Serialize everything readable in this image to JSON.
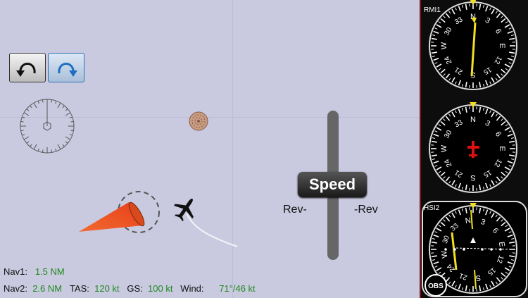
{
  "controls": {
    "turn_left_icon": "turn-left-arrow-icon",
    "turn_right_icon": "turn-right-arrow-icon",
    "speed_label": "Speed",
    "rev_minus_label": "Rev-",
    "rev_plus_label": "-Rev"
  },
  "status": {
    "nav1_label": "Nav1:",
    "nav1_value": "1.5 NM",
    "nav2_label": "Nav2:",
    "nav2_value": "2.6 NM",
    "tas_label": "TAS:",
    "tas_value": "120 kt",
    "gs_label": "GS:",
    "gs_value": "100 kt",
    "wind_label": "Wind:",
    "wind_value": "71°/46 kt"
  },
  "instruments": {
    "rmi1_label": "RMI1",
    "hsi2_label": "HSI2",
    "obs_label": "OBS",
    "compass_marks": [
      "N",
      "3",
      "6",
      "E",
      "12",
      "15",
      "S",
      "21",
      "24",
      "W",
      "30",
      "33"
    ]
  },
  "colors": {
    "map_background": "#c9c9e0",
    "value_green": "#1f8a1f",
    "needle_yellow": "#f0e020",
    "plane_red": "#e01010",
    "windsock_orange": "#f05a28"
  }
}
